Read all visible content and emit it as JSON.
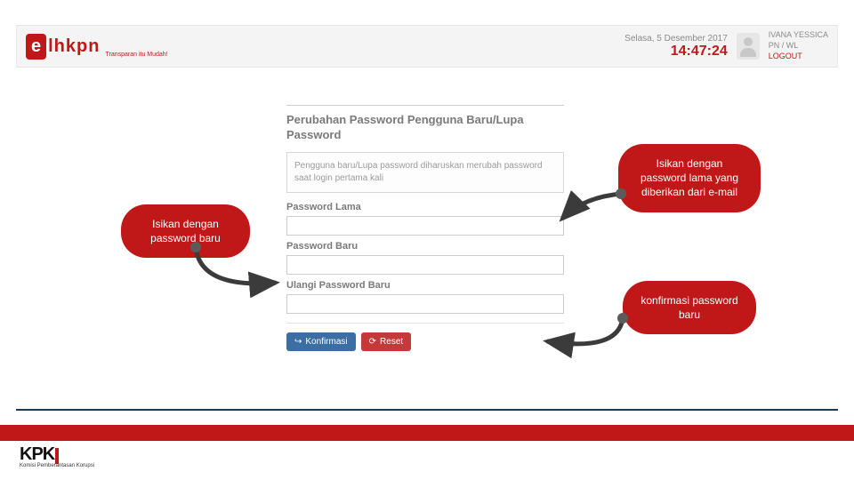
{
  "header": {
    "logo_e": "e",
    "logo_text": "lhkpn",
    "logo_sub": "Transparan itu Mudah!",
    "date": "Selasa, 5 Desember 2017",
    "clock": "14:47:24",
    "user_name": "IVANA YESSICA",
    "user_role": "PN / WL",
    "logout": "LOGOUT"
  },
  "form": {
    "title": "Perubahan Password Pengguna Baru/Lupa Password",
    "hint": "Pengguna baru/Lupa password diharuskan merubah password saat login pertama kali",
    "old_label": "Password Lama",
    "old_value": "",
    "new_label": "Password Baru",
    "new_value": "",
    "repeat_label": "Ulangi Password Baru",
    "repeat_value": "",
    "confirm_btn": "Konfirmasi",
    "reset_btn": "Reset"
  },
  "callouts": {
    "c1": "Isikan dengan password baru",
    "c2": "Isikan dengan password lama yang diberikan dari e-mail",
    "c3": "konfirmasi password baru"
  },
  "footer": {
    "kpk": "KPK",
    "kpk_sub": "Komisi Pemberantasan Korupsi"
  }
}
